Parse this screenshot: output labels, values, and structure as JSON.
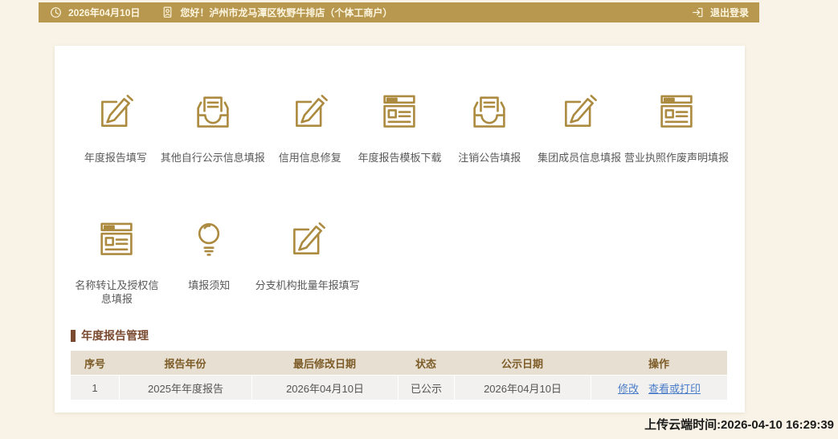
{
  "topbar": {
    "date": "2026年04月10日",
    "greeting": "您好！泸州市龙马潭区牧野牛排店（个体工商户）",
    "logout_label": "退出登录"
  },
  "launcher": {
    "row1": [
      {
        "label": "年度报告填写",
        "icon": "edit-icon"
      },
      {
        "label": "其他自行公示信息填报",
        "icon": "inbox-icon"
      },
      {
        "label": "信用信息修复",
        "icon": "edit-icon"
      },
      {
        "label": "年度报告模板下载",
        "icon": "browser-icon"
      },
      {
        "label": "注销公告填报",
        "icon": "inbox-icon"
      },
      {
        "label": "集团成员信息填报",
        "icon": "edit-icon"
      },
      {
        "label": "营业执照作废声明填报",
        "icon": "browser-icon"
      }
    ],
    "row2": [
      {
        "label": "名称转让及授权信息填报",
        "icon": "browser-icon"
      },
      {
        "label": "填报须知",
        "icon": "bulb-icon"
      },
      {
        "label": "分支机构批量年报填写",
        "icon": "edit-icon"
      }
    ]
  },
  "report": {
    "title": "年度报告管理",
    "table": {
      "headers": [
        "序号",
        "报告年份",
        "最后修改日期",
        "状态",
        "公示日期",
        "操作"
      ],
      "rows": [
        {
          "seq": "1",
          "year": "2025年年度报告",
          "modified": "2026年04月10日",
          "status": "已公示",
          "publish_date": "2026年04月10日",
          "actions": [
            "修改",
            "查看或打印"
          ]
        }
      ]
    }
  },
  "footer": {
    "upload_time": "上传云端时间:2026-04-10 16:29:39"
  },
  "colors": {
    "topbar_gold": "#b8974f",
    "page_beige": "#f8f3e6",
    "icon_gold": "#ac8b40",
    "section_brown": "#7a4a30",
    "table_header_bg": "#e7dfd1",
    "table_header_text": "#7d5c28",
    "row_bg": "#f2f1ef",
    "link_blue": "#4a7dc9"
  }
}
